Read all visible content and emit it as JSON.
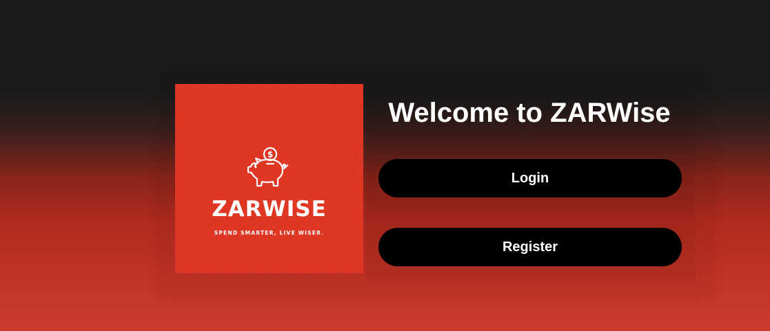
{
  "logo": {
    "brand_name": "ZARWISE",
    "tagline": "SPEND SMARTER, LIVE WISER.",
    "icon": "piggy-bank-dollar-icon",
    "background_color": "#e03624"
  },
  "welcome": {
    "title": "Welcome to ZARWise"
  },
  "actions": {
    "login_label": "Login",
    "register_label": "Register"
  },
  "colors": {
    "button_background": "#000000",
    "button_text": "#ffffff",
    "page_top": "#1b1b1b",
    "page_bottom": "#cd3b2f"
  }
}
